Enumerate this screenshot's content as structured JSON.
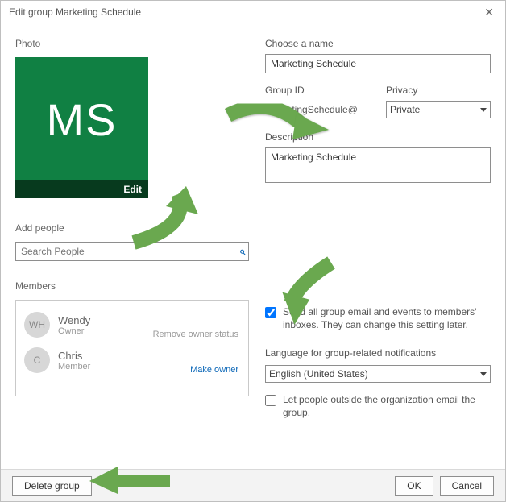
{
  "title": "Edit group Marketing Schedule",
  "photo": {
    "section_label": "Photo",
    "monogram": "MS",
    "edit_label": "Edit"
  },
  "name": {
    "label": "Choose a name",
    "value": "Marketing Schedule"
  },
  "group_id": {
    "label": "Group ID",
    "value": "MarketingSchedule@"
  },
  "privacy": {
    "label": "Privacy",
    "value": "Private"
  },
  "description": {
    "label": "Description",
    "value": "Marketing Schedule"
  },
  "add_people_label": "Add people",
  "search_placeholder": "Search People",
  "members_label": "Members",
  "members": [
    {
      "initials": "WH",
      "name": "Wendy",
      "role": "Owner",
      "action": "Remove owner status",
      "action_style": "grey"
    },
    {
      "initials": "C",
      "name": "Chris",
      "role": "Member",
      "action": "Make owner",
      "action_style": "link"
    }
  ],
  "send_all": {
    "checked": true,
    "text": "Send all group email and events to members' inboxes. They can change this setting later."
  },
  "language": {
    "label": "Language for group-related notifications",
    "value": "English (United States)"
  },
  "outside": {
    "checked": false,
    "text": "Let people outside the organization email the group."
  },
  "buttons": {
    "delete": "Delete group",
    "ok": "OK",
    "cancel": "Cancel"
  }
}
